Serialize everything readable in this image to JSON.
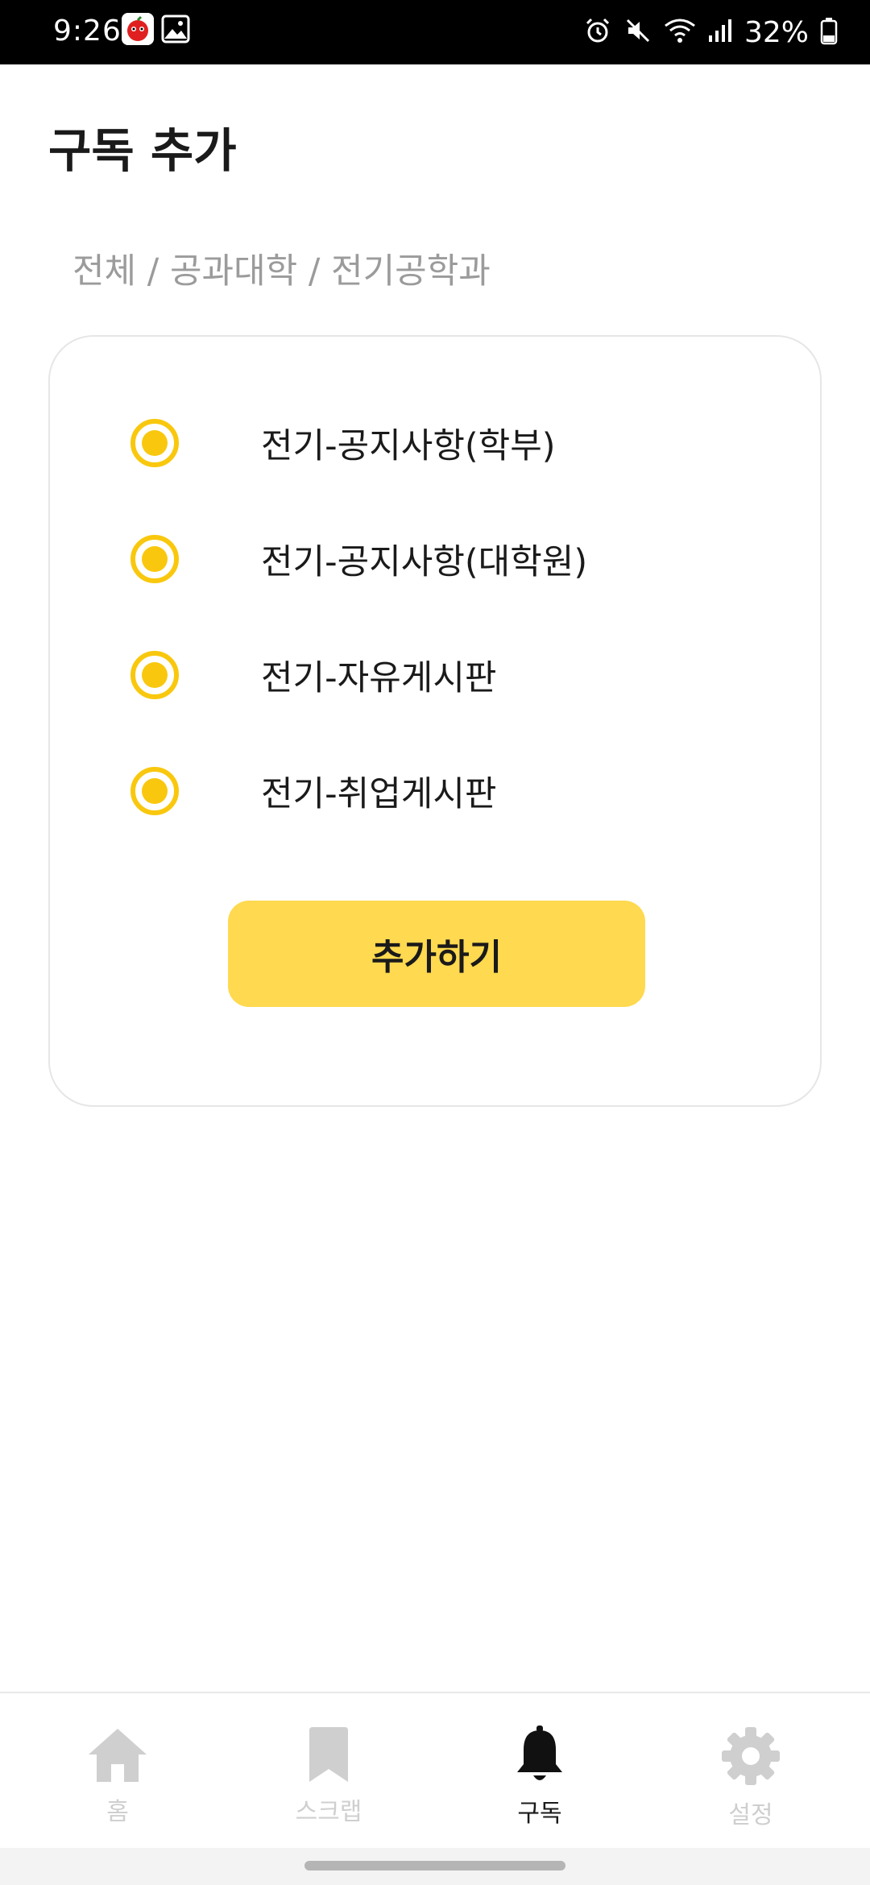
{
  "status_bar": {
    "time": "9:26",
    "battery": "32%",
    "icons": [
      "game-app-icon",
      "gallery-icon",
      "alarm-icon",
      "mute-icon",
      "wifi-icon",
      "signal-icon",
      "battery-icon"
    ]
  },
  "header": {
    "title": "구독 추가",
    "breadcrumb": "전체 / 공과대학 / 전기공학과"
  },
  "options": [
    {
      "label": "전기-공지사항(학부)",
      "selected": true
    },
    {
      "label": "전기-공지사항(대학원)",
      "selected": true
    },
    {
      "label": "전기-자유게시판",
      "selected": true
    },
    {
      "label": "전기-취업게시판",
      "selected": true
    }
  ],
  "actions": {
    "add_label": "추가하기"
  },
  "bottom_nav": {
    "items": [
      {
        "label": "홈",
        "icon": "home-icon",
        "active": false
      },
      {
        "label": "스크랩",
        "icon": "bookmark-icon",
        "active": false
      },
      {
        "label": "구독",
        "icon": "bell-icon",
        "active": true
      },
      {
        "label": "설정",
        "icon": "gear-icon",
        "active": false
      }
    ]
  },
  "colors": {
    "accent": "#f9c80e",
    "button": "#ffd94f",
    "inactive": "#cfcfcf"
  }
}
